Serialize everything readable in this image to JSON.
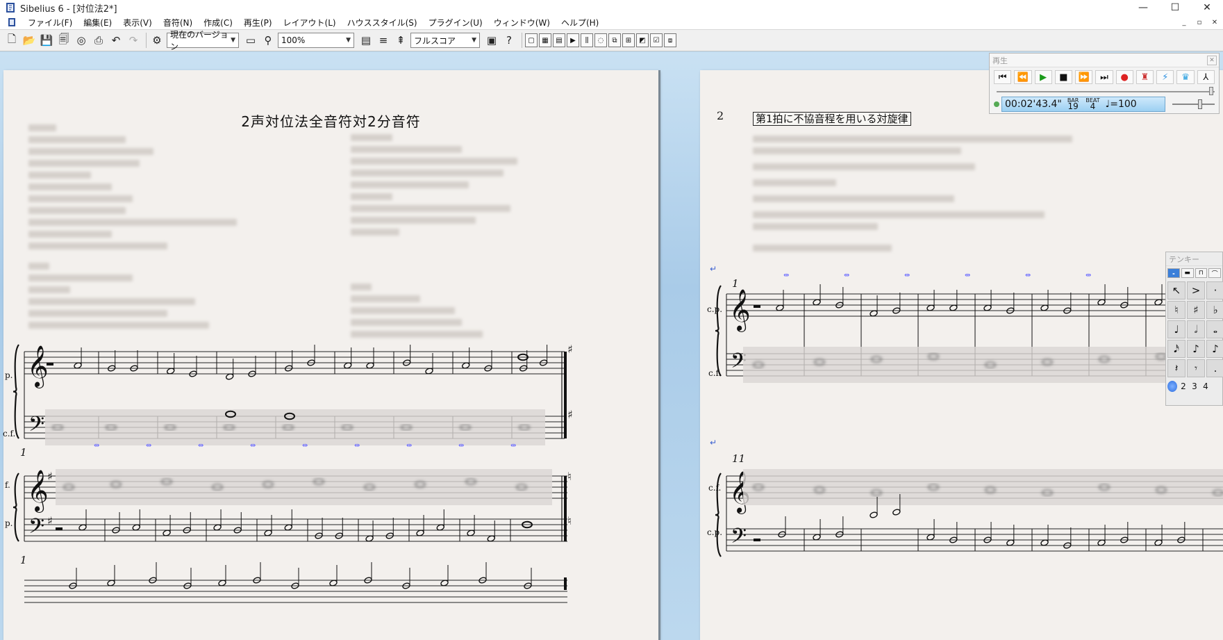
{
  "window": {
    "title": "Sibelius 6 - [対位法2*]",
    "controls": {
      "minimize": "—",
      "maximize": "☐",
      "close": "✕"
    }
  },
  "menubar": {
    "items": [
      "ファイル(F)",
      "編集(E)",
      "表示(V)",
      "音符(N)",
      "作成(C)",
      "再生(P)",
      "レイアウト(L)",
      "ハウススタイル(S)",
      "プラグイン(U)",
      "ウィンドウ(W)",
      "ヘルプ(H)"
    ],
    "mdi_controls": [
      "_",
      "▫",
      "✕"
    ]
  },
  "toolbar": {
    "version_select": "現在のバージョン",
    "zoom_select": "100%",
    "view_select": "フルスコア",
    "help_glyph": "?"
  },
  "score": {
    "title": "2声対位法全音符対2分音符",
    "page2_number": "2",
    "page2_heading": "第1拍に不協音程を用いる対旋律",
    "labels": {
      "cp": "c.p.",
      "cf": "c.f.",
      "p": "p.",
      "f": "f."
    },
    "bar_numbers": {
      "left_sys2": "1",
      "left_sys3": "1",
      "right_sys1": "1",
      "right_sys2": "11"
    }
  },
  "playback": {
    "title": "再生",
    "close": "✕",
    "time": "00:02'43.4\"",
    "bar_label": "BAR",
    "bar": "19",
    "beat_label": "BEAT",
    "beat": "4",
    "tempo": "♩=100"
  },
  "keypad": {
    "title": "テンキー",
    "keys": [
      "↖",
      ">",
      "·",
      "♮",
      "♯",
      "♭",
      "♩",
      "𝅗𝅥",
      "𝅝",
      "𝅘𝅥𝅯",
      "♪",
      "♪",
      "𝄽",
      "𝄾",
      "."
    ],
    "bottom": [
      "2",
      "3",
      "4"
    ]
  }
}
